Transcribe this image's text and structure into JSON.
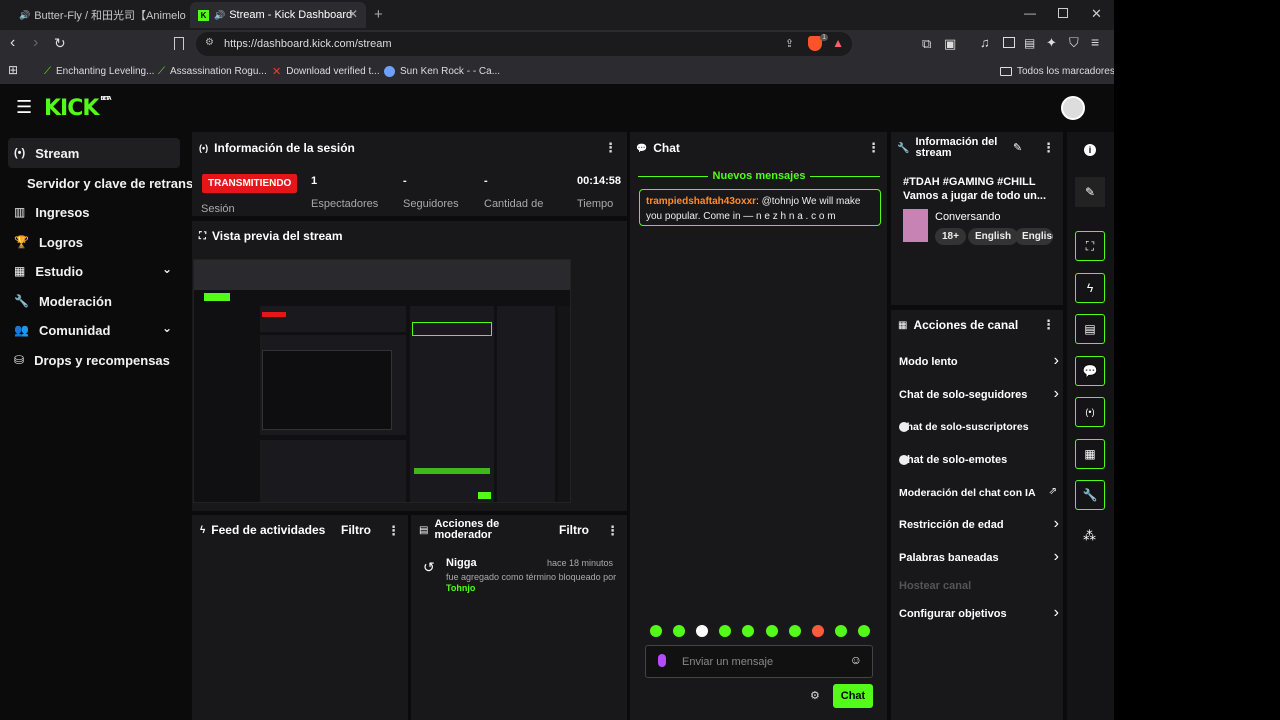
{
  "browser": {
    "tabs": [
      {
        "title": "Butter-Fly / 和田光司【Animelo Su"
      },
      {
        "title": "Stream - Kick Dashboard"
      }
    ],
    "url": "https://dashboard.kick.com/stream",
    "bookmarks": [
      "Enchanting Leveling...",
      "Assassination Rogu...",
      "Download verified t...",
      "Sun Ken Rock - - Ca..."
    ],
    "all_bookmarks": "Todos los marcadores",
    "brave_badge": "1"
  },
  "brand": {
    "logo": "KICK",
    "beta": "BETA",
    "accent": "#53fc18"
  },
  "sidebar": {
    "items": [
      {
        "label": "Stream",
        "icon": "broadcast-icon"
      },
      {
        "label": "Servidor y clave de retransmisión",
        "icon": ""
      },
      {
        "label": "Ingresos",
        "icon": "chart-icon"
      },
      {
        "label": "Logros",
        "icon": "trophy-icon"
      },
      {
        "label": "Estudio",
        "icon": "studio-icon"
      },
      {
        "label": "Moderación",
        "icon": "wrench-icon"
      },
      {
        "label": "Comunidad",
        "icon": "community-icon"
      },
      {
        "label": "Drops y recompensas",
        "icon": "drops-icon"
      }
    ]
  },
  "session": {
    "title": "Información de la sesión",
    "status": "TRANSMITIENDO",
    "status_label": "Sesión",
    "viewers": "1",
    "viewers_label": "Espectadores",
    "followers": "-",
    "followers_label": "Seguidores",
    "amount": "-",
    "amount_label": "Cantidad de",
    "time": "00:14:58",
    "time_label": "Tiempo"
  },
  "preview": {
    "title": "Vista previa del stream"
  },
  "feed": {
    "title": "Feed de actividades",
    "filter": "Filtro"
  },
  "modactions": {
    "title": "Acciones de moderador",
    "filter": "Filtro",
    "entry": {
      "user": "Nigga",
      "time": "hace 18 minutos",
      "text": "fue agregado como término bloqueado por",
      "by": "Tohnjo"
    }
  },
  "chat": {
    "title": "Chat",
    "new_messages": "Nuevos mensajes",
    "message": {
      "user": "trampiedshaftah43oxxr",
      "sep": ":",
      "text": " @tohnjo We will make you popular. Come in — n e z h n a . c o m"
    },
    "placeholder": "Enviar un mensaje",
    "send": "Chat"
  },
  "streaminfo": {
    "title": "Información del stream",
    "stream_title": "#TDAH #GAMING #CHILL Vamos a jugar de todo un...",
    "category": "Conversando",
    "tags": [
      "18+",
      "English",
      "English"
    ]
  },
  "channel_actions": {
    "title": "Acciones de canal",
    "items": [
      {
        "label": "Modo lento",
        "kind": "chevron"
      },
      {
        "label": "Chat de solo-seguidores",
        "kind": "chevron"
      },
      {
        "label": "Chat de solo-suscriptores",
        "kind": "toggle"
      },
      {
        "label": "Chat de solo-emotes",
        "kind": "toggle"
      },
      {
        "label": "Moderación del chat con IA",
        "kind": "external"
      },
      {
        "label": "Restricción de edad",
        "kind": "chevron"
      },
      {
        "label": "Palabras baneadas",
        "kind": "chevron"
      },
      {
        "label": "Hostear canal",
        "kind": "disabled"
      },
      {
        "label": "Configurar objetivos",
        "kind": "chevron"
      }
    ]
  }
}
